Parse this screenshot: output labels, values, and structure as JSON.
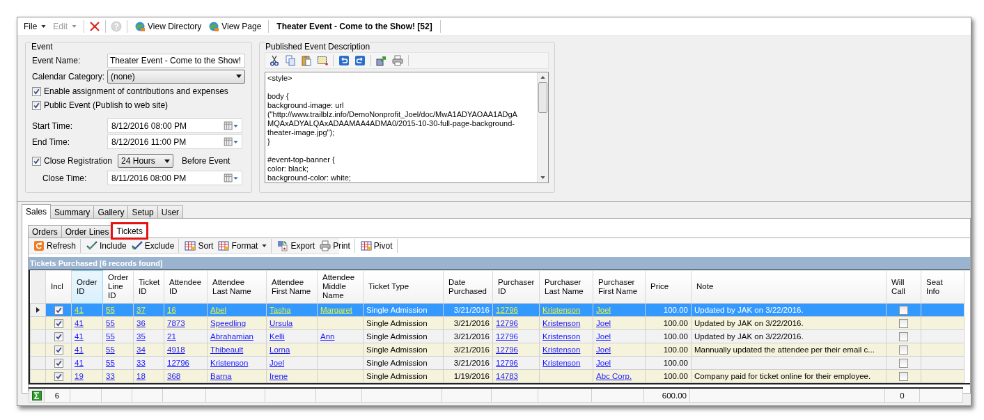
{
  "menu": [
    {
      "label": "File",
      "disabled": false
    },
    {
      "label": "Edit",
      "disabled": true
    }
  ],
  "help_button": {
    "disabled": true
  },
  "link_buttons": [
    {
      "label": "View Directory"
    },
    {
      "label": "View Page"
    }
  ],
  "document_title": "Theater Event - Come to the Show! [52]",
  "event": {
    "title": "Event",
    "name_label": "Event Name:",
    "name_value": "Theater Event - Come to the Show!",
    "category_label": "Calendar Category:",
    "category_value": "(none)",
    "options": [
      {
        "label": "Enable assignment of contributions and expenses",
        "checked": true
      },
      {
        "label": "Public Event (Publish to web site)",
        "checked": true
      }
    ],
    "start_label": "Start Time:",
    "start_value": "8/12/2016 08:00 PM",
    "end_label": "End Time:",
    "end_value": "8/12/2016 11:00 PM",
    "close_registration": {
      "label": "Close Registration",
      "checked": true,
      "value": "24 Hours",
      "suffix": "Before Event"
    },
    "close_label": "Close Time:",
    "close_value": "8/11/2016 08:00 PM"
  },
  "description": {
    "title": "Published Event Description",
    "blocks": [
      [
        "<style>"
      ],
      [
        "body {",
        "background-image: url",
        "(\"http://www.trailblz.info/DemoNonprofit_Joel/doc/MwA1ADYAOAA1ADgA",
        "MQAxADYALQAxADAAMAA4ADMA0/2015-10-30-full-page-background-",
        "theater-image.jpg\");",
        "}"
      ],
      [
        "#event-top-banner {",
        "color: black;",
        "background-color: white;"
      ]
    ]
  },
  "tabs": [
    {
      "label": "Sales",
      "selected": true
    },
    {
      "label": "Summary",
      "selected": false
    },
    {
      "label": "Gallery",
      "selected": false
    },
    {
      "label": "Setup",
      "selected": false
    },
    {
      "label": "User",
      "selected": false
    }
  ],
  "subtabs": [
    {
      "label": "Orders",
      "selected": false,
      "highlighted": false
    },
    {
      "label": "Order Lines",
      "selected": false,
      "highlighted": false
    },
    {
      "label": "Tickets",
      "selected": true,
      "highlighted": true
    }
  ],
  "grid_toolbar": [
    {
      "label": "Refresh",
      "kind": "refresh",
      "separator": true
    },
    {
      "label": "Include",
      "kind": "include",
      "separator": false
    },
    {
      "label": "Exclude",
      "kind": "exclude",
      "separator": true
    },
    {
      "label": "Sort",
      "kind": "grid",
      "separator": false
    },
    {
      "label": "Format",
      "kind": "grid",
      "dropdown": true,
      "separator": true
    },
    {
      "label": "Export",
      "kind": "export",
      "separator": false
    },
    {
      "label": "Print",
      "kind": "print",
      "separator": true
    },
    {
      "label": "Pivot",
      "kind": "grid",
      "separator": true
    }
  ],
  "grid": {
    "caption": "Tickets Purchased [6 records found]",
    "columns": [
      {
        "label": "Incl",
        "kind": "check",
        "selected": false
      },
      {
        "label": "Order\nID",
        "kind": "link",
        "selected": true
      },
      {
        "label": "Order\nLine\nID",
        "kind": "link",
        "selected": false
      },
      {
        "label": "Ticket\nID",
        "kind": "link",
        "selected": false
      },
      {
        "label": "Attendee\nID",
        "kind": "link",
        "selected": false
      },
      {
        "label": "Attendee\nLast Name",
        "kind": "link",
        "selected": false
      },
      {
        "label": "Attendee\nFirst Name",
        "kind": "link",
        "selected": false
      },
      {
        "label": "Attendee\nMiddle\nName",
        "kind": "link",
        "selected": false
      },
      {
        "label": "Ticket Type",
        "kind": "text",
        "selected": false
      },
      {
        "label": "Date\nPurchased",
        "kind": "number",
        "selected": false
      },
      {
        "label": "Purchaser\nID",
        "kind": "link",
        "selected": false
      },
      {
        "label": "Purchaser\nLast Name",
        "kind": "link",
        "selected": false
      },
      {
        "label": "Purchaser\nFirst Name",
        "kind": "link",
        "selected": false
      },
      {
        "label": "Price",
        "kind": "number",
        "selected": false
      },
      {
        "label": "Note",
        "kind": "text",
        "selected": false
      },
      {
        "label": "Will\nCall",
        "kind": "check",
        "selected": false
      },
      {
        "label": "Seat\nInfo",
        "kind": "text",
        "selected": false
      }
    ],
    "rows": [
      {
        "selected": true,
        "cells": [
          true,
          "41",
          "55",
          "37",
          "16",
          "Abel",
          "Tasha",
          "Margaret",
          "Single Admission",
          "3/21/2016",
          "12796",
          "Kristenson",
          "Joel",
          "100.00",
          "Updated by JAK on 3/22/2016.",
          false,
          null
        ]
      },
      {
        "selected": false,
        "cells": [
          true,
          "41",
          "55",
          "36",
          "7873",
          "Speedling",
          "Ursula",
          null,
          "Single Admission",
          "3/21/2016",
          "12796",
          "Kristenson",
          "Joel",
          "100.00",
          "Updated by JAK on 3/22/2016.",
          false,
          null
        ]
      },
      {
        "selected": false,
        "cells": [
          true,
          "41",
          "55",
          "35",
          "21",
          "Abrahamian",
          "Kelli",
          "Ann",
          "Single Admission",
          "3/21/2016",
          "12796",
          "Kristenson",
          "Joel",
          "100.00",
          "Updated by JAK on 3/22/2016.",
          false,
          null
        ]
      },
      {
        "selected": false,
        "cells": [
          true,
          "41",
          "55",
          "34",
          "4918",
          "Thibeault",
          "Lorna",
          null,
          "Single Admission",
          "3/21/2016",
          "12796",
          "Kristenson",
          "Joel",
          "100.00",
          "Mannually updated the attendee per their email c...",
          false,
          null
        ]
      },
      {
        "selected": false,
        "cells": [
          true,
          "41",
          "55",
          "33",
          "12796",
          "Kristenson",
          "Joel",
          null,
          "Single Admission",
          "3/21/2016",
          "12796",
          "Kristenson",
          "Joel",
          "100.00",
          null,
          false,
          null
        ]
      },
      {
        "selected": false,
        "cells": [
          true,
          "19",
          "33",
          "18",
          "368",
          "Barna",
          "Irene",
          null,
          "Single Admission",
          "1/19/2016",
          "14783",
          null,
          "Abc Corp.",
          "100.00",
          "Company paid for ticket online for their employee.",
          false,
          null
        ]
      }
    ],
    "footer": {
      "count": "6",
      "price_total": "600.00",
      "will_call_total": "0"
    }
  }
}
